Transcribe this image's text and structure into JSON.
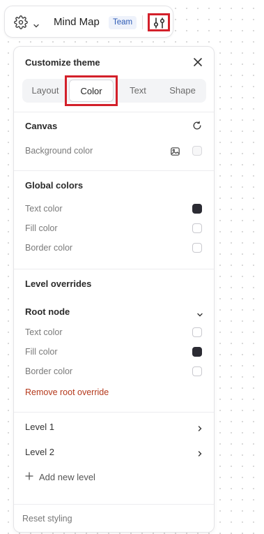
{
  "toolbar": {
    "title": "Mind Map",
    "badge": "Team",
    "icons": {
      "settings": "gear-icon",
      "menu": "chevron-down-icon",
      "theme": "theme-sliders-icon"
    }
  },
  "panel": {
    "title": "Customize theme",
    "tabs": [
      {
        "label": "Layout",
        "selected": false
      },
      {
        "label": "Color",
        "selected": true
      },
      {
        "label": "Text",
        "selected": false
      },
      {
        "label": "Shape",
        "selected": false
      }
    ],
    "canvas": {
      "title": "Canvas",
      "background_label": "Background color"
    },
    "global": {
      "title": "Global colors",
      "rows": [
        {
          "label": "Text color",
          "value": "#2b2b33"
        },
        {
          "label": "Fill color",
          "value": "none"
        },
        {
          "label": "Border color",
          "value": "none"
        }
      ]
    },
    "levels": {
      "title": "Level overrides",
      "root": {
        "title": "Root node",
        "rows": [
          {
            "label": "Text color",
            "value": "none"
          },
          {
            "label": "Fill color",
            "value": "#2b2b33"
          },
          {
            "label": "Border color",
            "value": "none"
          }
        ],
        "remove_label": "Remove root override"
      },
      "items": [
        {
          "label": "Level 1"
        },
        {
          "label": "Level 2"
        }
      ],
      "add_label": "Add new level"
    },
    "footer": {
      "reset_label": "Reset styling"
    }
  },
  "colors": {
    "accent_highlight": "#d3202a",
    "danger": "#b5391c",
    "badge_bg": "#eef2fb",
    "badge_text": "#2d5bb5"
  }
}
